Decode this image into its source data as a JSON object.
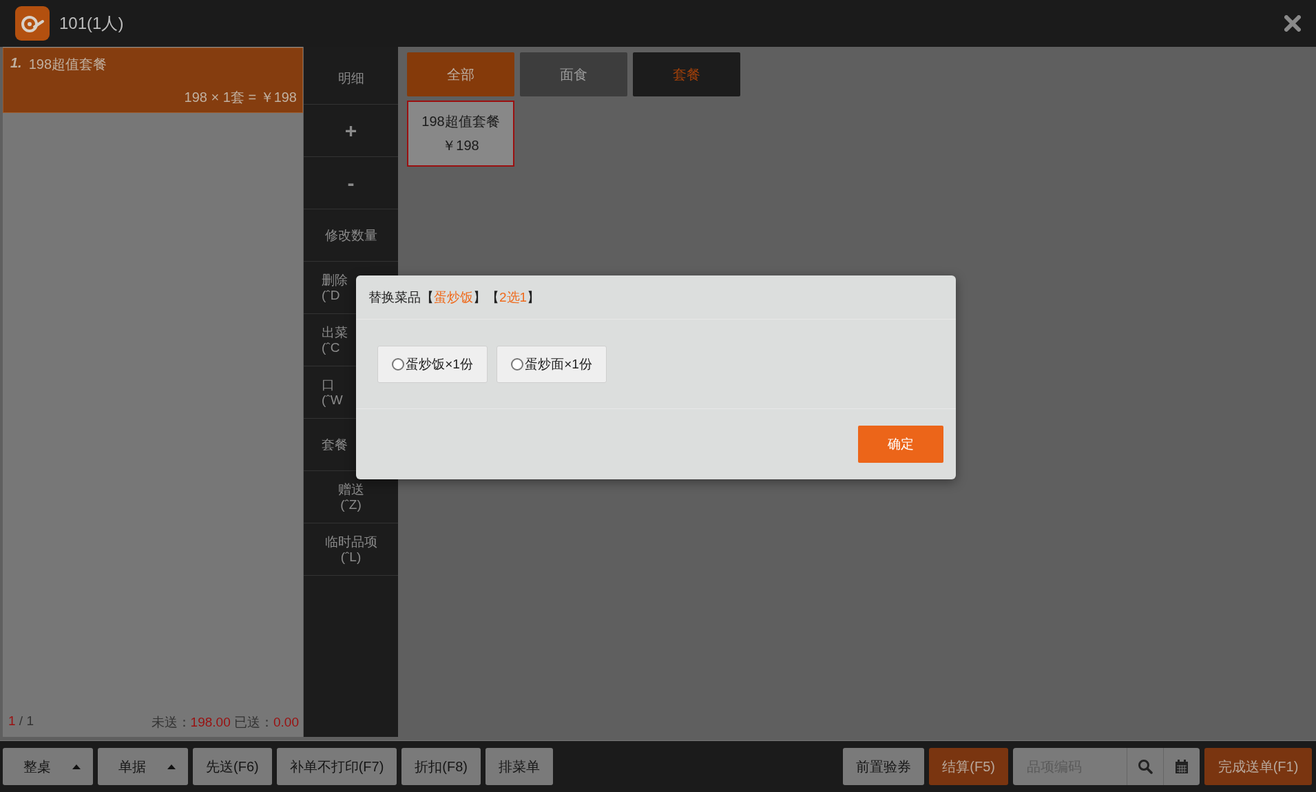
{
  "header": {
    "title": "101(1人)"
  },
  "order": {
    "items": [
      {
        "index": "1.",
        "name": "198超值套餐",
        "detail": "198 × 1套 = ￥198",
        "selected": true
      }
    ],
    "pager": {
      "current": "1",
      "separator": "/",
      "total": "1"
    },
    "totals": [
      {
        "label": "未送：",
        "value": "198.00"
      },
      {
        "label": "已送：",
        "value": "0.00"
      }
    ]
  },
  "actions": [
    {
      "kind": "full",
      "lines": [
        "明细"
      ]
    },
    {
      "kind": "symbol",
      "lines": [
        "+"
      ]
    },
    {
      "kind": "symbol",
      "lines": [
        "-"
      ]
    },
    {
      "kind": "full",
      "lines": [
        "修改数量"
      ]
    },
    {
      "kind": "cut",
      "lines": [
        "删除",
        "(ˆD"
      ]
    },
    {
      "kind": "cut",
      "lines": [
        "出菜",
        "(ˆC"
      ]
    },
    {
      "kind": "cut",
      "lines": [
        "口",
        "(ˆW"
      ]
    },
    {
      "kind": "cut",
      "lines": [
        "套餐"
      ]
    },
    {
      "kind": "full",
      "lines": [
        "赠送",
        "(ˆZ)"
      ]
    },
    {
      "kind": "full",
      "lines": [
        "临时品项",
        "(ˆL)"
      ]
    }
  ],
  "categories": [
    {
      "label": "全部",
      "selected": true,
      "kind": "normal"
    },
    {
      "label": "面食",
      "selected": false,
      "kind": "normal"
    },
    {
      "label": "套餐",
      "selected": false,
      "kind": "accent"
    }
  ],
  "products": [
    {
      "name": "198超值套餐",
      "price": "￥198",
      "selected": true
    }
  ],
  "toolbar_left": [
    {
      "label": "整桌",
      "caret": true
    },
    {
      "label": "单据",
      "caret": true
    },
    {
      "label": "先送(F6)",
      "caret": false
    },
    {
      "label": "补单不打印(F7)",
      "caret": false
    },
    {
      "label": "折扣(F8)",
      "caret": false
    },
    {
      "label": "排菜单",
      "caret": false
    }
  ],
  "toolbar_right": {
    "voucher": "前置验券",
    "settle": "结算(F5)",
    "search": {
      "placeholder": "品项编码"
    },
    "finish": "完成送单(F1)"
  },
  "dialog": {
    "title_parts": [
      {
        "text": "替换菜品【",
        "accent": false
      },
      {
        "text": "蛋炒饭",
        "accent": true
      },
      {
        "text": "】【",
        "accent": false
      },
      {
        "text": "2选1",
        "accent": true
      },
      {
        "text": "】",
        "accent": false
      }
    ],
    "options": [
      {
        "label": "蛋炒饭×1份",
        "selected": false
      },
      {
        "label": "蛋炒面×1份",
        "selected": false
      }
    ],
    "confirm": "确定"
  }
}
